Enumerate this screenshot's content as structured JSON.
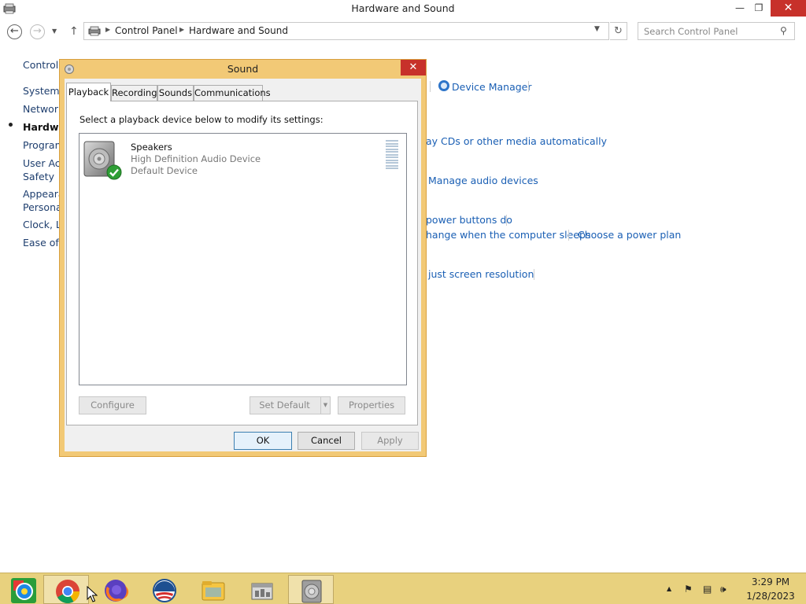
{
  "window": {
    "title": "Hardware and Sound",
    "minimize": "—",
    "maximize": "❐",
    "close": "✕"
  },
  "navigation": {
    "back": "←",
    "forward": "→",
    "recent": "▼",
    "up": "↑",
    "breadcrumbs": [
      "Control Panel",
      "Hardware and Sound"
    ],
    "refresh": "↻",
    "search_placeholder": "Search Control Panel",
    "search_icon": "⚲"
  },
  "left_nav": {
    "items": [
      "Control",
      "System",
      "Network",
      "Hardware",
      "Programs",
      "User Ac",
      "Safety",
      "Appearar",
      "Personal",
      "Clock, Lo",
      "Ease of"
    ],
    "current_index": 3
  },
  "main_links": {
    "device_manager": "Device Manager",
    "autoplay": "ay CDs or other media automatically",
    "manage_audio": "Manage audio devices",
    "power_buttons": "power buttons do",
    "sleep": "hange when the computer sleeps",
    "power_plan": "Choose a power plan",
    "resolution": "just screen resolution"
  },
  "dialog": {
    "title": "Sound",
    "close": "✕",
    "tabs": [
      "Playback",
      "Recording",
      "Sounds",
      "Communications"
    ],
    "active_tab": "Playback",
    "instruction": "Select a playback device below to modify its settings:",
    "device": {
      "name": "Speakers",
      "description": "High Definition Audio Device",
      "status": "Default Device",
      "icon": "speaker-icon",
      "badge_icon": "check-icon"
    },
    "buttons": {
      "configure": "Configure",
      "set_default": "Set Default",
      "set_default_arrow": "▼",
      "properties": "Properties",
      "ok": "OK",
      "cancel": "Cancel",
      "apply": "Apply"
    }
  },
  "taskbar": {
    "apps": [
      "app-icon",
      "chrome-icon",
      "firefox-icon",
      "obama-logo-icon",
      "file-explorer-icon",
      "control-panel-icon",
      "sound-icon"
    ],
    "tray": {
      "up_arrow": "▲",
      "flag": "⚑",
      "network": "▤",
      "volume": "🕪"
    },
    "time": "3:29 PM",
    "date": "1/28/2023"
  },
  "colors": {
    "taskbar": "#e8d17e",
    "dialog_frame": "#f2c976",
    "link": "#1a5fb4",
    "close_button": "#c7312a"
  }
}
